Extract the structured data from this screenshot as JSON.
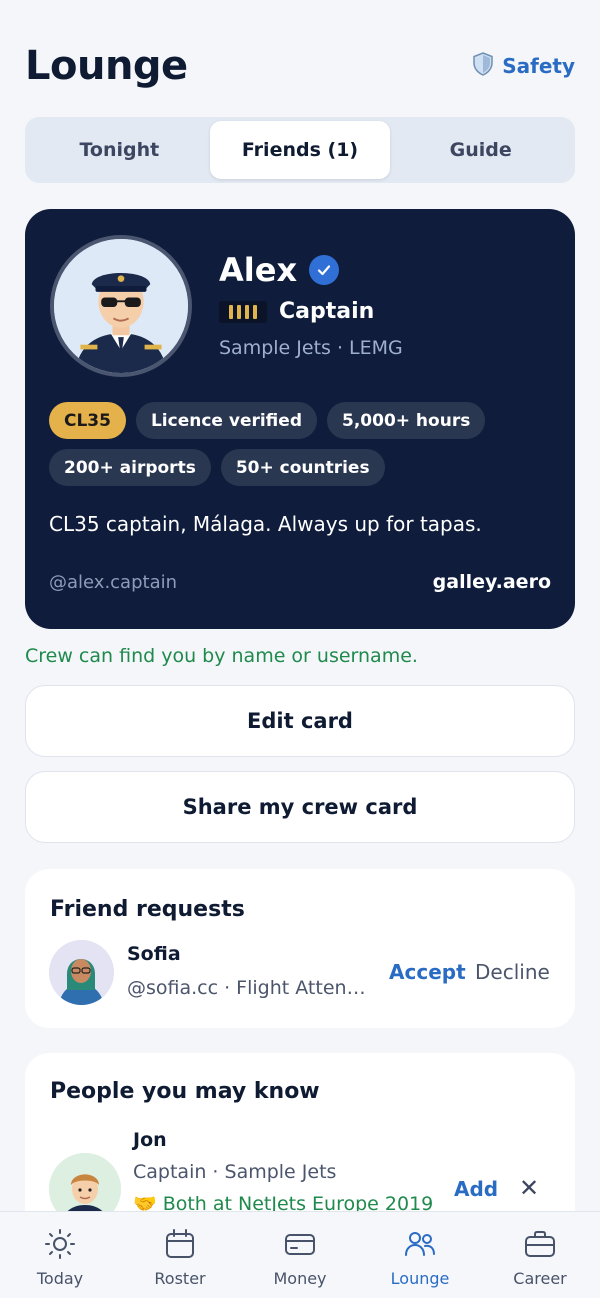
{
  "header": {
    "title": "Lounge",
    "safety_label": "Safety"
  },
  "tabs": [
    {
      "label": "Tonight",
      "active": false
    },
    {
      "label": "Friends (1)",
      "active": true
    },
    {
      "label": "Guide",
      "active": false
    }
  ],
  "crew_card": {
    "name": "Alex",
    "verified": true,
    "rank": "Captain",
    "company": "Sample Jets · LEMG",
    "chips": [
      "CL35",
      "Licence verified",
      "5,000+ hours",
      "200+ airports",
      "50+ countries"
    ],
    "bio": "CL35 captain, Málaga. Always up for tapas.",
    "handle": "@alex.captain",
    "site": "galley.aero"
  },
  "find_note": "Crew can find you by name or username.",
  "buttons": {
    "edit": "Edit card",
    "share": "Share my crew card"
  },
  "friend_requests": {
    "title": "Friend requests",
    "items": [
      {
        "name": "Sofia",
        "sub": "@sofia.cc · Flight Attendant",
        "accept": "Accept",
        "decline": "Decline"
      }
    ]
  },
  "people": {
    "title": "People you may know",
    "items": [
      {
        "name": "Jon",
        "sub": "Captain · Sample Jets",
        "mutual": "🤝 Both at NetJets Europe 2019",
        "add": "Add",
        "dismiss": "✕"
      }
    ]
  },
  "tabbar": [
    {
      "label": "Today",
      "icon": "sun-icon",
      "active": false
    },
    {
      "label": "Roster",
      "icon": "calendar-icon",
      "active": false
    },
    {
      "label": "Money",
      "icon": "card-icon",
      "active": false
    },
    {
      "label": "Lounge",
      "icon": "people-icon",
      "active": true
    },
    {
      "label": "Career",
      "icon": "briefcase-icon",
      "active": false
    }
  ],
  "colors": {
    "accent": "#2a6cc4",
    "card_bg": "#0f1c3b",
    "success": "#1f8a4c",
    "gold": "#e5b14a"
  }
}
